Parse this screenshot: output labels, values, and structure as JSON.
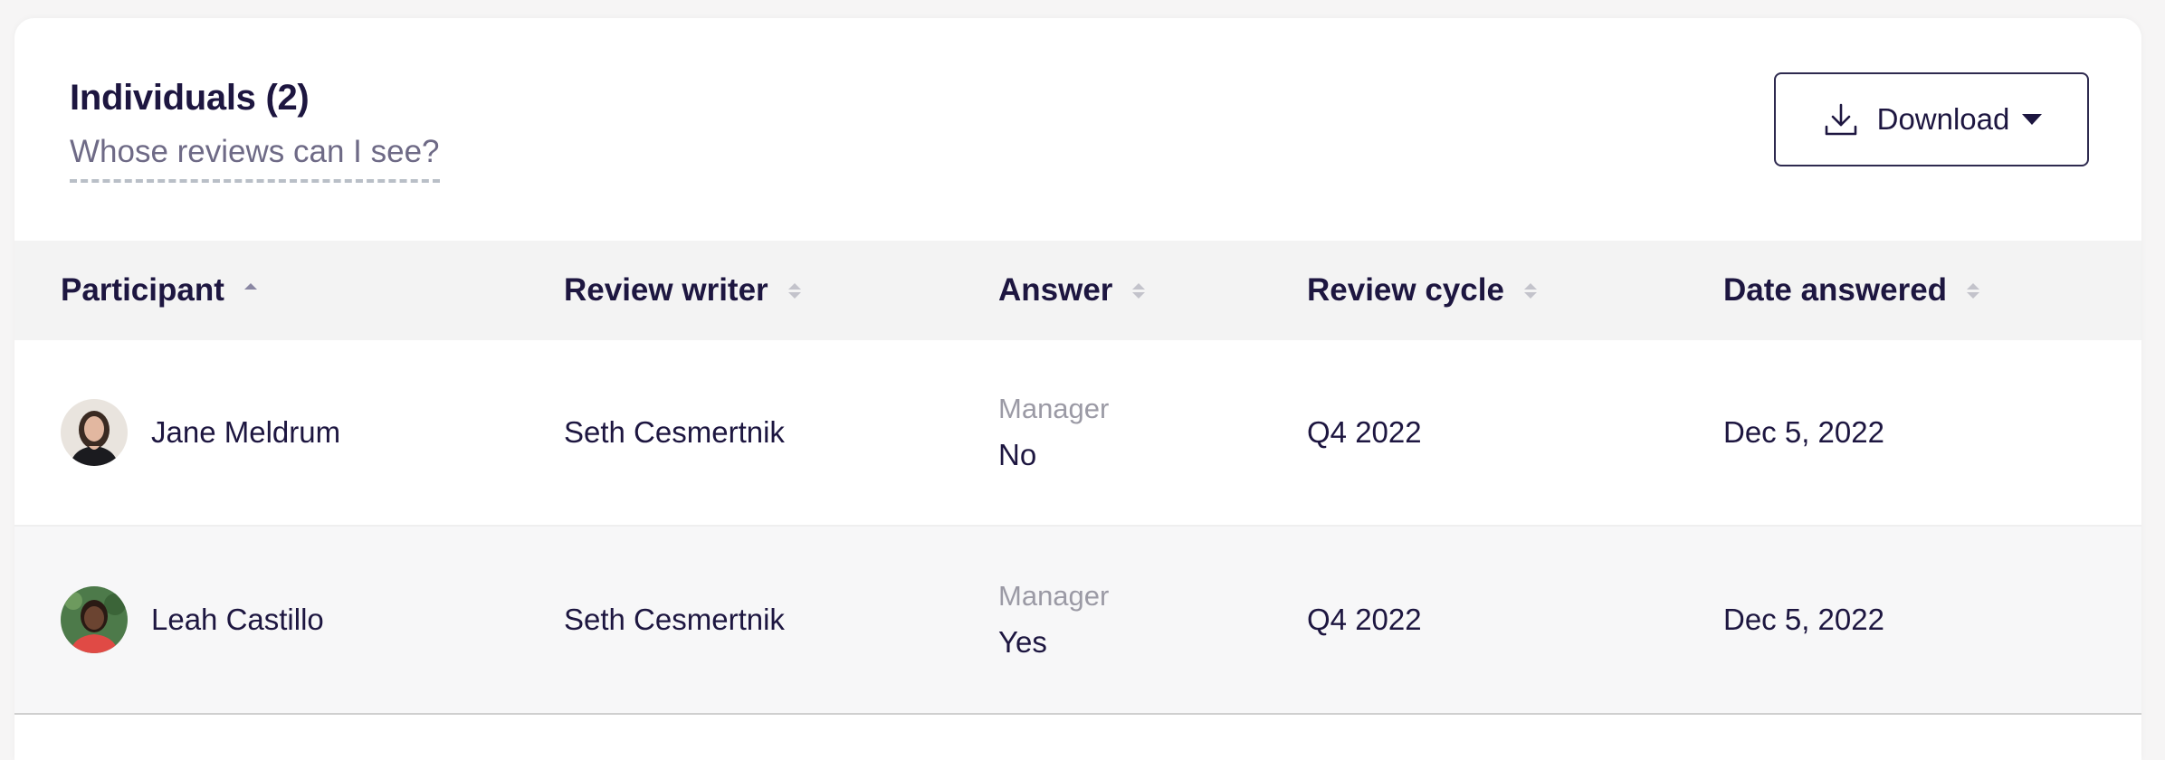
{
  "header": {
    "title": "Individuals (2)",
    "help_link": "Whose reviews can I see?",
    "download_label": "Download"
  },
  "columns": [
    {
      "label": "Participant",
      "sort": "ascending"
    },
    {
      "label": "Review writer",
      "sort": "none"
    },
    {
      "label": "Answer",
      "sort": "none"
    },
    {
      "label": "Review cycle",
      "sort": "none"
    },
    {
      "label": "Date answered",
      "sort": "none"
    }
  ],
  "rows": [
    {
      "participant": "Jane Meldrum",
      "review_writer": "Seth Cesmertnik",
      "answer_role": "Manager",
      "answer_value": "No",
      "review_cycle": "Q4 2022",
      "date_answered": "Dec 5, 2022"
    },
    {
      "participant": "Leah Castillo",
      "review_writer": "Seth Cesmertnik",
      "answer_role": "Manager",
      "answer_value": "Yes",
      "review_cycle": "Q4 2022",
      "date_answered": "Dec 5, 2022"
    }
  ],
  "icons": {
    "download": "download-icon",
    "dropdown": "caret-down-icon",
    "sort": "sort-icon"
  },
  "colors": {
    "text_primary": "#1d1640",
    "text_muted": "#6e6a86",
    "header_bg": "#f3f3f3",
    "row_alt_bg": "#f7f7f8"
  }
}
